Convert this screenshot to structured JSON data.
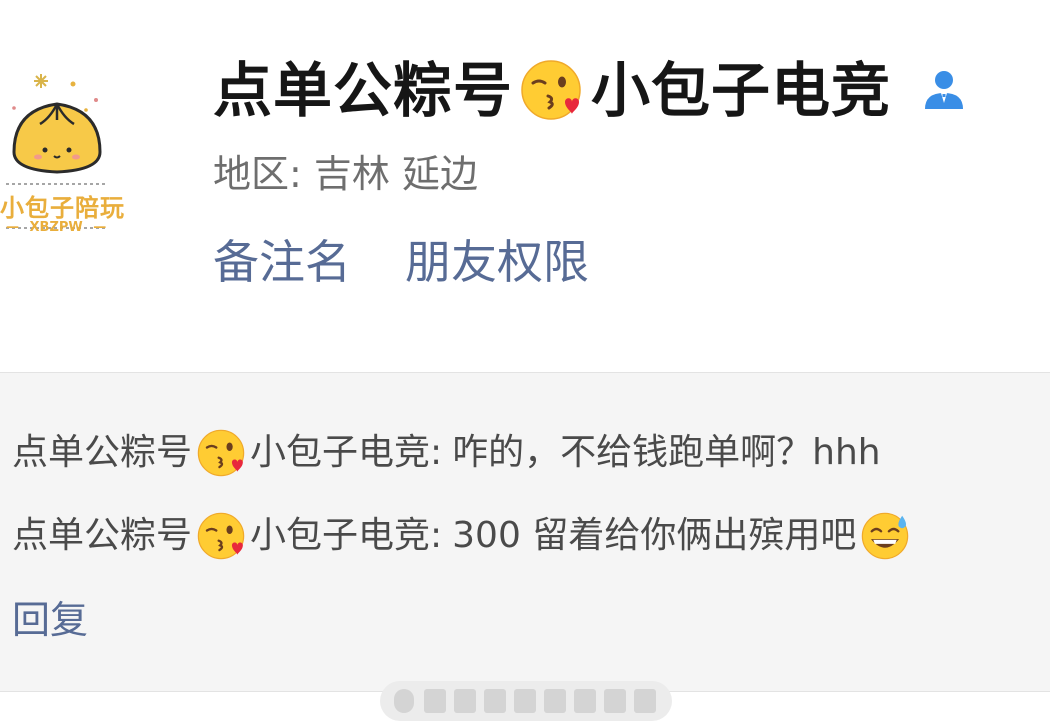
{
  "profile": {
    "name_before_emoji": "点单公粽号",
    "name_after_emoji": "小包子电竞",
    "name_emoji": "kissing-face-with-heart-emoji",
    "contact_icon": "person-contact-icon",
    "region": "地区: 吉林  延边",
    "avatar": {
      "logo_text": "小包子陪玩",
      "logo_subtext": "XBZPW"
    }
  },
  "links": {
    "remark_name": "备注名",
    "friend_permissions": "朋友权限"
  },
  "comments": [
    {
      "author_before_emoji": "点单公粽号",
      "author_after_emoji": "小包子电竞:",
      "text": "咋的，不给钱跑单啊？hhh"
    },
    {
      "author_before_emoji": "点单公粽号",
      "author_after_emoji": "小包子电竞:",
      "text": "300 留着给你俩出殡用吧",
      "trailing_emoji": "grinning-sweat-emoji"
    }
  ],
  "reply_label": "回复",
  "colors": {
    "link_blue": "#576b95",
    "panel_bg": "#f5f5f5",
    "name_text": "#161616",
    "region_text": "#6e6e6e",
    "contact_icon_blue": "#3a8ee6"
  }
}
